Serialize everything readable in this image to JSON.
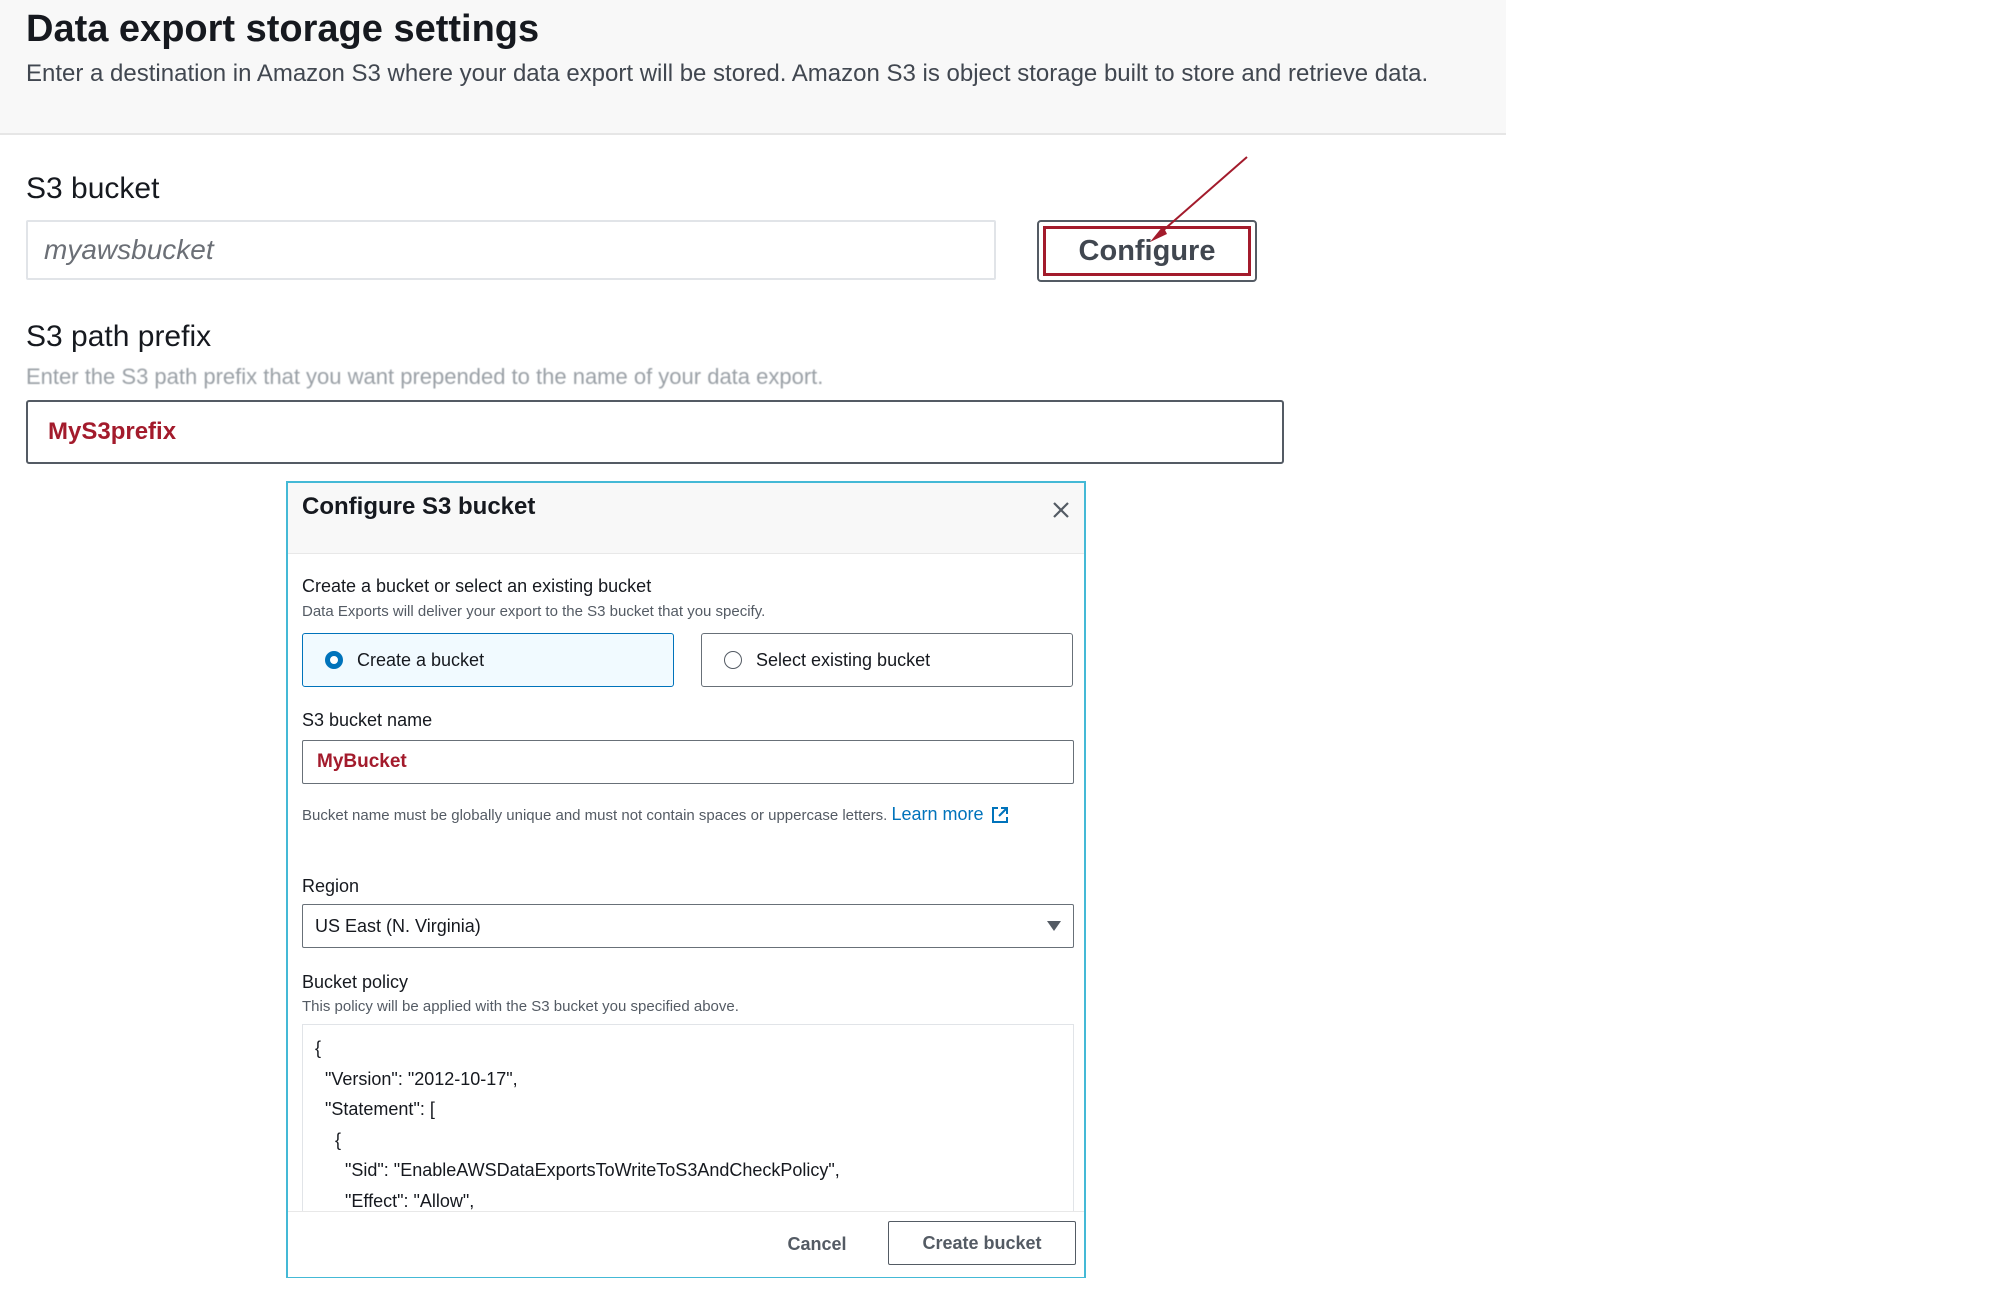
{
  "page": {
    "title": "Data export storage settings",
    "description": "Enter a destination in Amazon S3 where your data export will be stored. Amazon S3 is object storage built to store and retrieve data."
  },
  "s3_bucket": {
    "label": "S3 bucket",
    "placeholder": "myawsbucket",
    "configure_label": "Configure"
  },
  "s3_prefix": {
    "label": "S3 path prefix",
    "description": "Enter the S3 path prefix that you want prepended to the name of your data export.",
    "value": "MyS3prefix"
  },
  "modal": {
    "title": "Configure S3 bucket",
    "bucket_choice": {
      "label": "Create a bucket or select an existing bucket",
      "hint": "Data Exports will deliver your export to the S3 bucket that you specify.",
      "options": [
        "Create a bucket",
        "Select existing bucket"
      ],
      "selected": "Create a bucket"
    },
    "bucket_name": {
      "label": "S3 bucket name",
      "value": "MyBucket",
      "hint": "Bucket name must be globally unique and must not contain spaces or uppercase letters.",
      "learn_more": "Learn more"
    },
    "region": {
      "label": "Region",
      "value": "US East (N. Virginia)"
    },
    "policy": {
      "label": "Bucket policy",
      "hint": "This policy will be applied with the S3 bucket you specified above.",
      "lines": [
        "{",
        "  \"Version\": \"2012-10-17\",",
        "  \"Statement\": [",
        "    {",
        "      \"Sid\": \"EnableAWSDataExportsToWriteToS3AndCheckPolicy\",",
        "      \"Effect\": \"Allow\","
      ]
    },
    "cancel_label": "Cancel",
    "create_label": "Create bucket"
  },
  "colors": {
    "accent_link": "#0073bb",
    "annotation_red": "#a31b2c",
    "modal_border": "#44b9d6"
  },
  "icons": [
    "close-icon",
    "external-link-icon",
    "caret-down-icon",
    "annotation-arrow"
  ]
}
